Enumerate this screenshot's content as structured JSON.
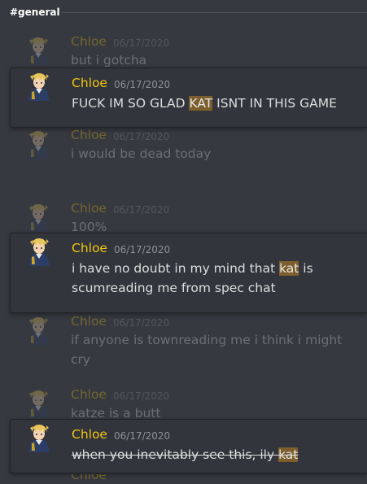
{
  "channel": {
    "name": "#general"
  },
  "messages": [
    {
      "author": "Chloe",
      "timestamp": "06/17/2020",
      "before": "but i gotcha",
      "match": "",
      "after": ""
    },
    {
      "author": "Chloe",
      "timestamp": "06/17/2020",
      "before": "FUCK IM SO GLAD ",
      "match": "KAT",
      "after": " ISNT IN THIS GAME"
    },
    {
      "author": "Chloe",
      "timestamp": "06/17/2020",
      "before": "i would be dead today",
      "match": "",
      "after": ""
    },
    {
      "author": "Chloe",
      "timestamp": "06/17/2020",
      "before": "100%",
      "match": "",
      "after": ""
    },
    {
      "author": "Chloe",
      "timestamp": "06/17/2020",
      "before": "i have no doubt in my mind that ",
      "match": "kat",
      "after": " is scumreading me from spec chat"
    },
    {
      "author": "Chloe",
      "timestamp": "06/17/2020",
      "before": "if anyone is townreading me i think i might cry",
      "match": "",
      "after": ""
    },
    {
      "author": "Chloe",
      "timestamp": "06/17/2020",
      "before": "katze is a butt",
      "match": "",
      "after": ""
    },
    {
      "author": "Chloe",
      "timestamp": "06/17/2020",
      "before": "when you inevitably see this, ily ",
      "match": "kat",
      "after": ""
    },
    {
      "author": "Chloe",
      "timestamp": "",
      "before": "",
      "match": "",
      "after": ""
    }
  ],
  "colors": {
    "author": "#f1c40f",
    "highlight": "#7d5f2e",
    "background": "#36393f"
  }
}
